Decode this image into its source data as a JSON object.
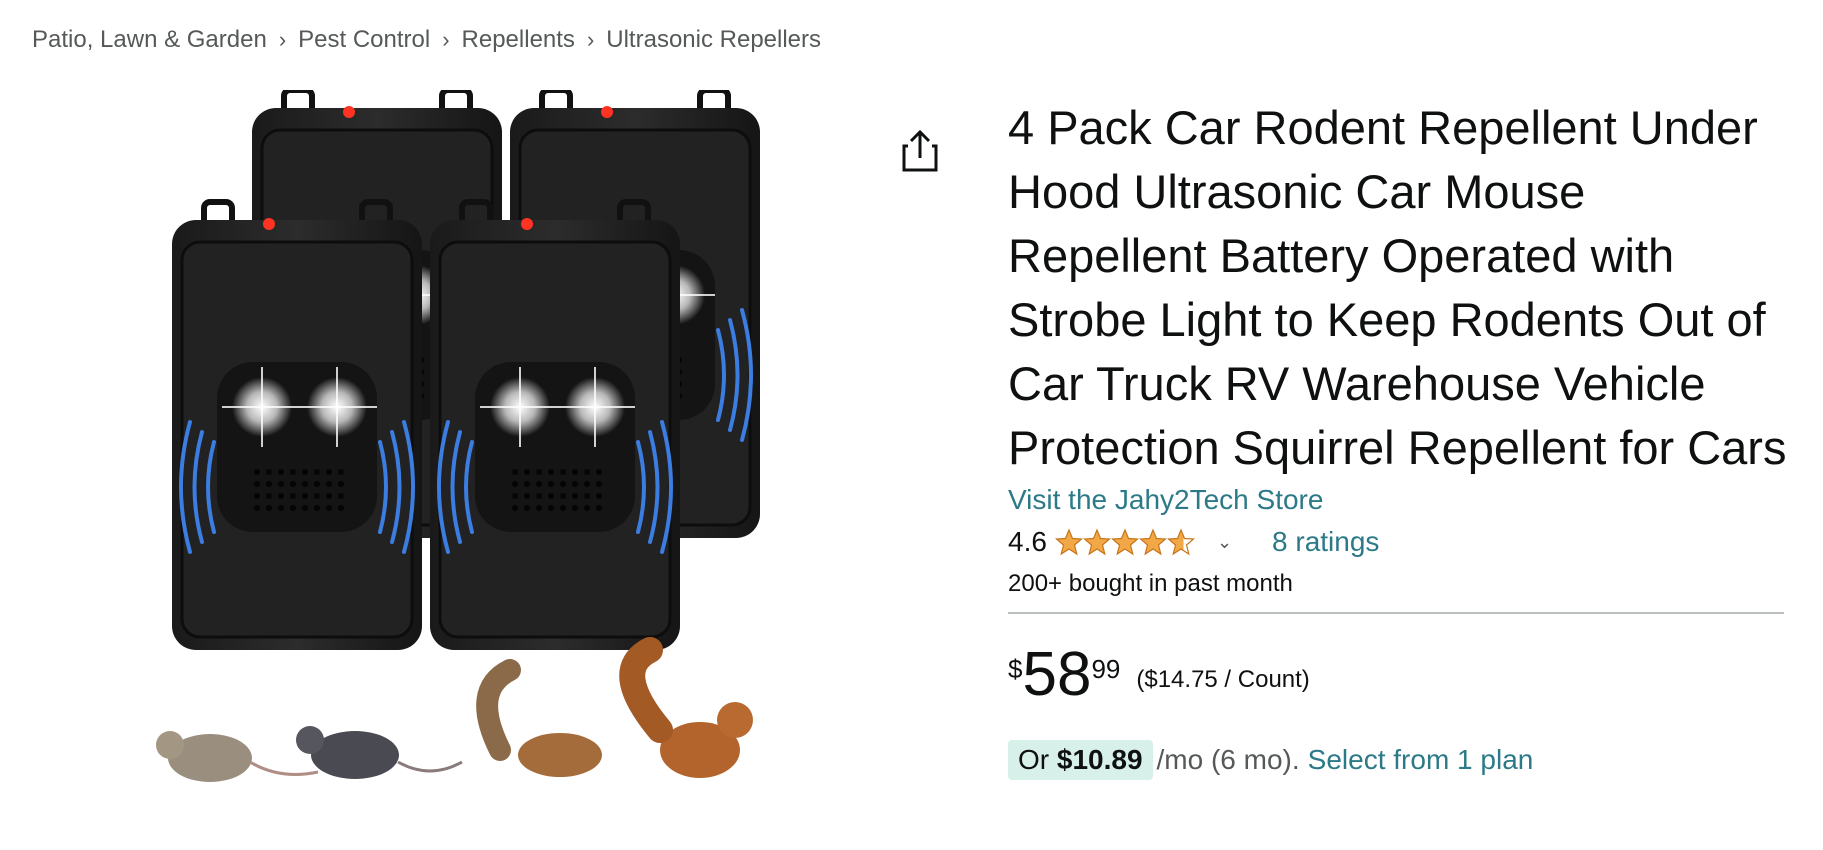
{
  "breadcrumb": [
    "Patio, Lawn & Garden",
    "Pest Control",
    "Repellents",
    "Ultrasonic Repellers"
  ],
  "product": {
    "title": "4 Pack Car Rodent Repellent Under Hood Ultrasonic Car Mouse Repellent Battery Operated with Strobe Light to Keep Rodents Out of Car Truck RV Warehouse Vehicle Protection Squirrel Repellent for Cars",
    "store_link": "Visit the Jahy2Tech Store",
    "rating": "4.6",
    "rating_value": 4.6,
    "ratings_count": "8 ratings",
    "bought": "200+ bought in past month"
  },
  "price": {
    "symbol": "$",
    "whole": "58",
    "fraction": "99",
    "unit": "($14.75 / Count)"
  },
  "plan": {
    "or": "Or",
    "amount": "$10.89",
    "term": "/mo (6 mo).",
    "link": "Select from 1 plan"
  },
  "colors": {
    "link": "#2c7a88",
    "star": "#f3a847",
    "plan_badge": "#d7f0ea",
    "text": "#0f1111",
    "muted": "#565959"
  },
  "icons": {
    "share": "share-icon",
    "chevron": "chevron-down-icon",
    "star": "star-icon"
  }
}
